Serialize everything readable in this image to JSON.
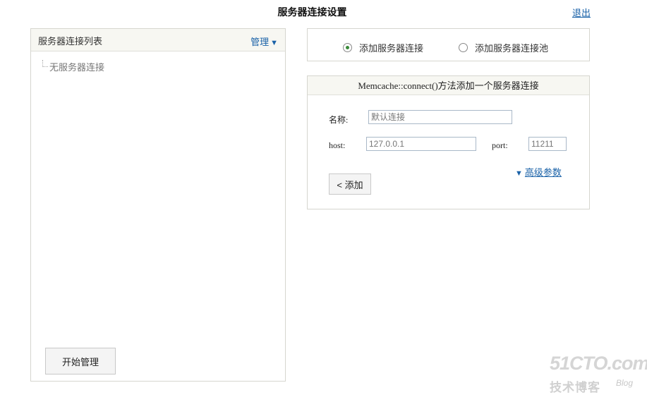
{
  "page": {
    "title": "服务器连接设置",
    "logout_label": "退出"
  },
  "left_panel": {
    "title": "服务器连接列表",
    "manage_label": "管理",
    "manage_arrow": "▼",
    "empty_text": "无服务器连接",
    "start_button_label": "开始管理"
  },
  "mode": {
    "options": [
      {
        "label": "添加服务器连接",
        "checked": true
      },
      {
        "label": "添加服务器连接池",
        "checked": false
      }
    ]
  },
  "form": {
    "header": "Memcache::connect()方法添加一个服务器连接",
    "name_label": "名称:",
    "name_value": "默认连接",
    "host_label": "host:",
    "host_value": "127.0.0.1",
    "port_label": "port:",
    "port_value": "11211",
    "advanced_arrow": "▼",
    "advanced_label": "高级参数",
    "add_button_label": "< 添加"
  },
  "watermark": {
    "brand": "51CTO.com",
    "subtitle": "技术博客",
    "blog": "Blog"
  }
}
